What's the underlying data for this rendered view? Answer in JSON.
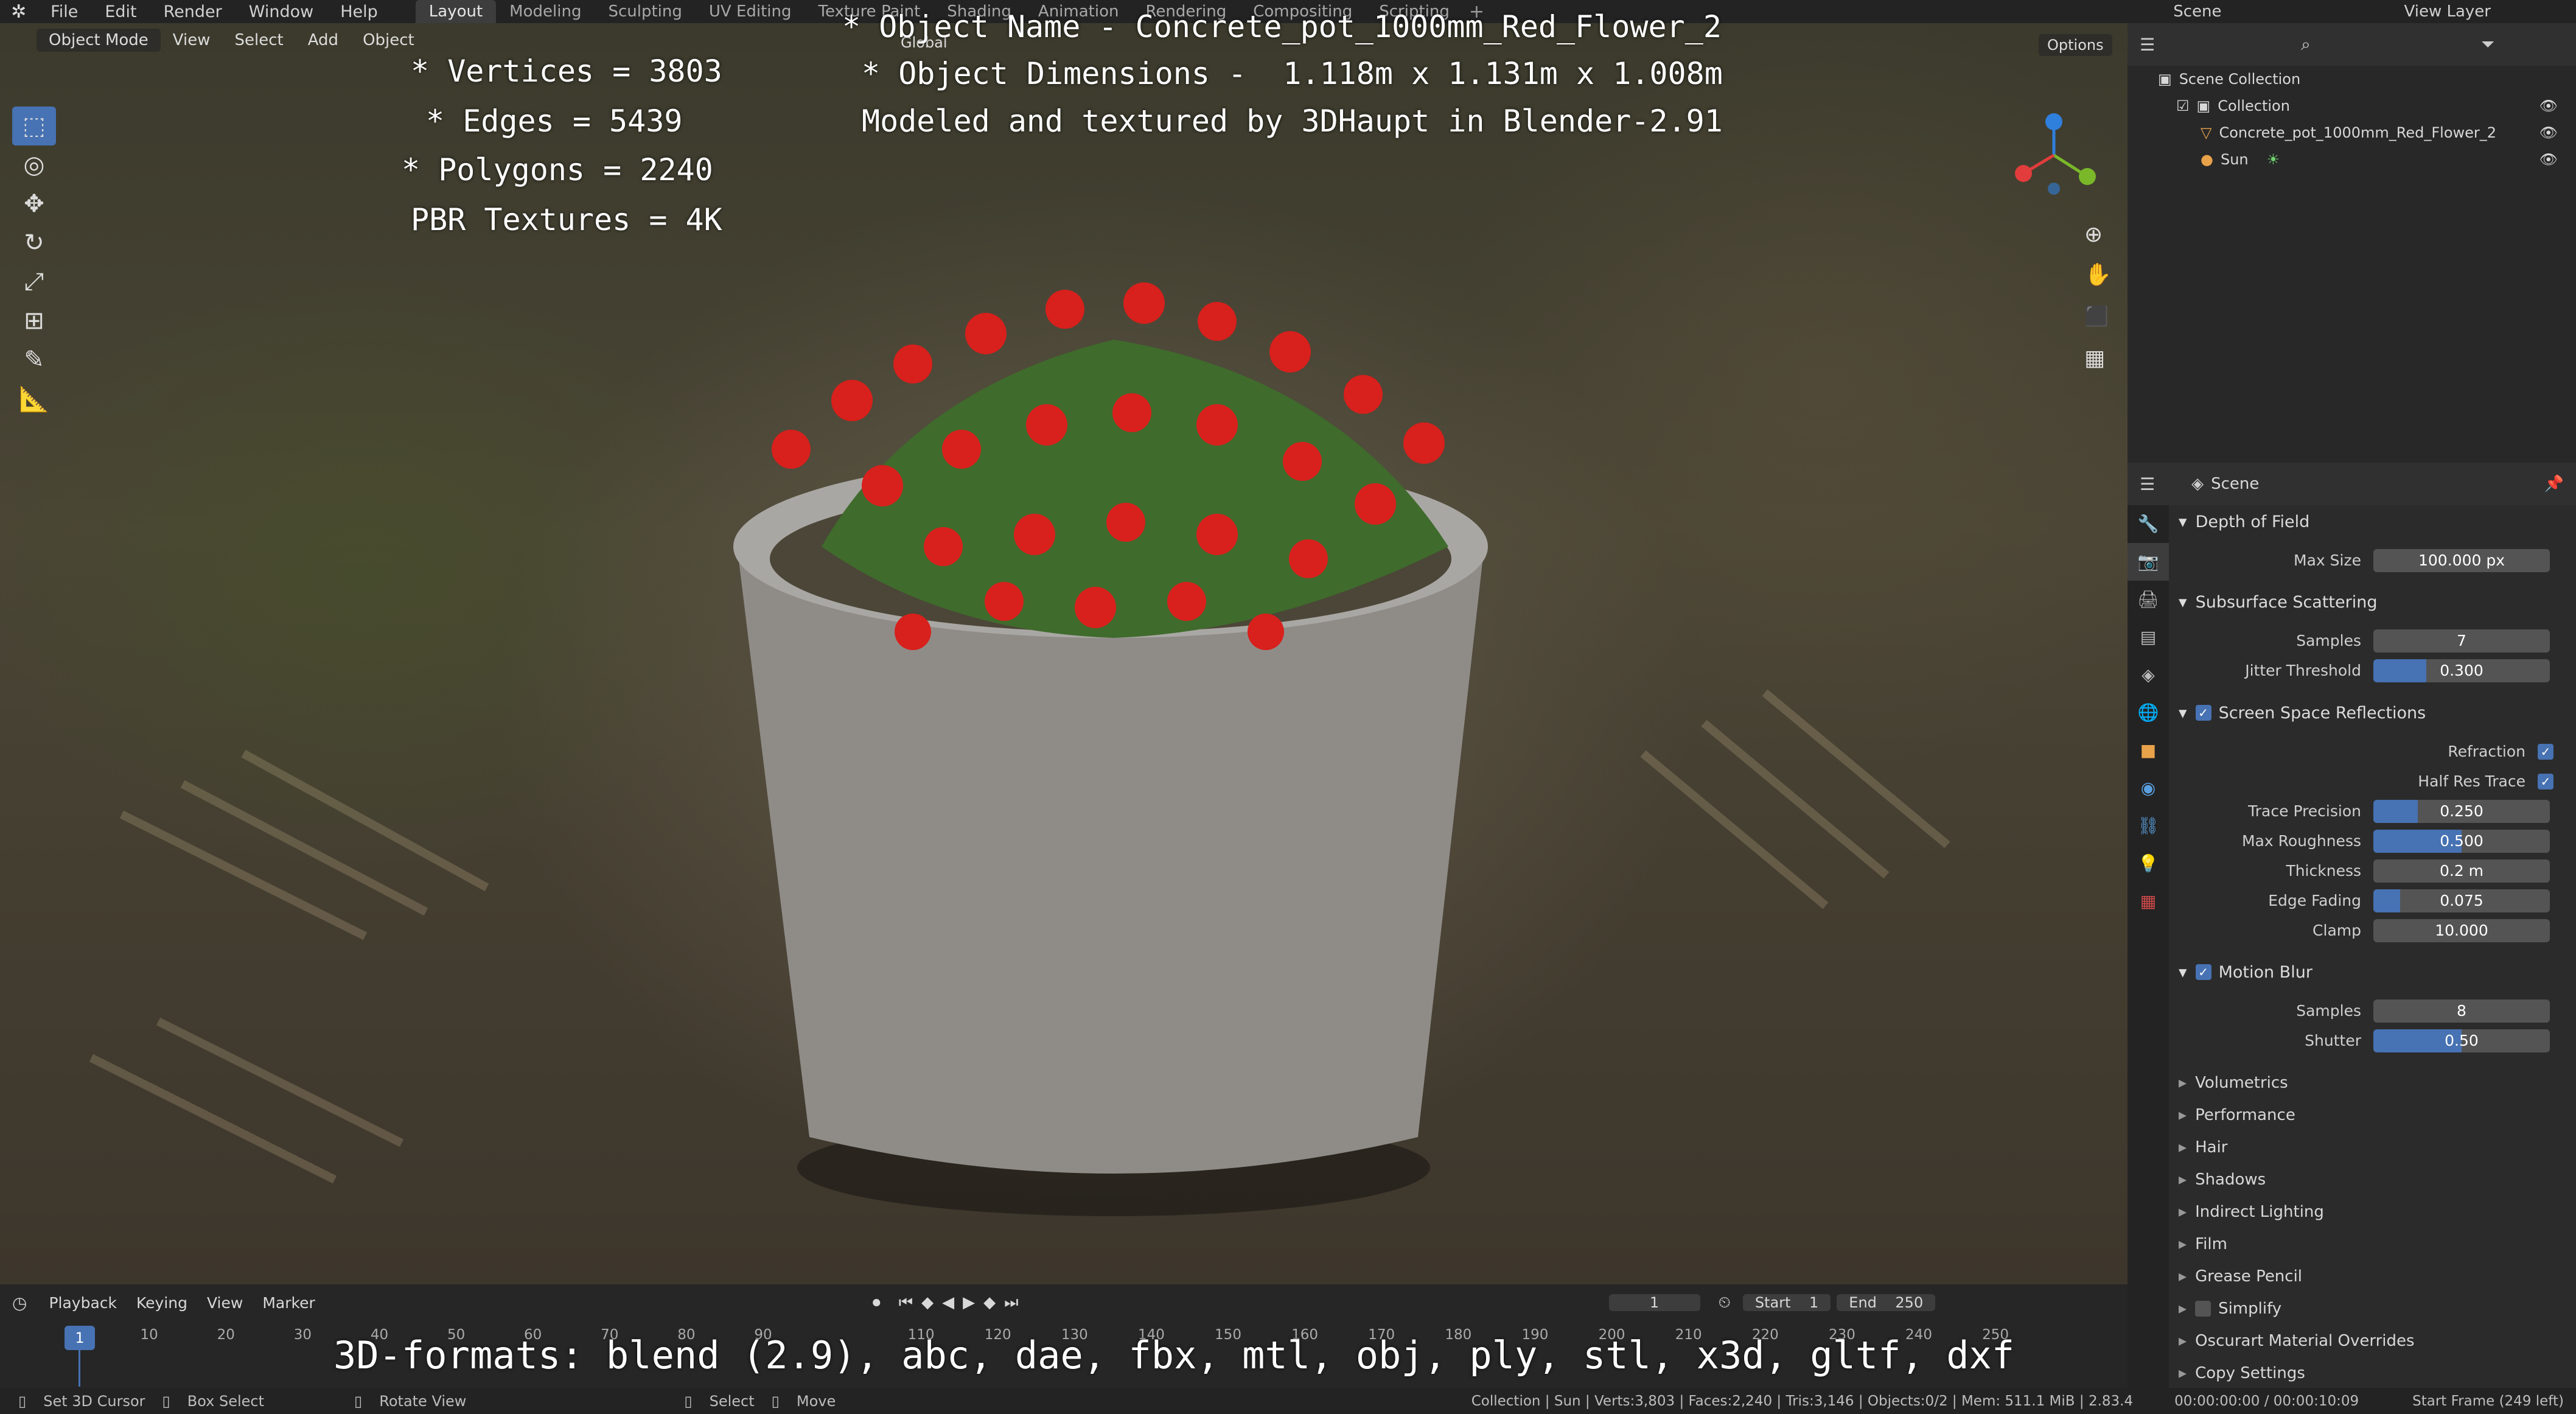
{
  "topbar": {
    "menus": [
      "File",
      "Edit",
      "Render",
      "Window",
      "Help"
    ],
    "workspaces": [
      "Layout",
      "Modeling",
      "Sculpting",
      "UV Editing",
      "Texture Paint",
      "Shading",
      "Animation",
      "Rendering",
      "Compositing",
      "Scripting"
    ],
    "active_workspace": "Layout",
    "scene_label": "Scene",
    "view_layer_label": "View Layer"
  },
  "viewport": {
    "mode": "Object Mode",
    "menus": [
      "View",
      "Select",
      "Add",
      "Object"
    ],
    "transform_orientation": "Global",
    "options_label": "Options"
  },
  "overlay": {
    "stats": [
      "* Vertices = 3803",
      "* Edges = 5439",
      "* Polygons = 2240",
      "PBR Textures = 4K"
    ],
    "info": [
      "* Object Name - Concrete_pot_1000mm_Red_Flower_2",
      "* Object Dimensions -  1.118m x 1.131m x 1.008m",
      "Modeled and textured by 3DHaupt in Blender-2.91"
    ],
    "formats": "3D-formats: blend (2.9), abc, dae, fbx, mtl, obj, ply, stl, x3d, gltf, dxf"
  },
  "outliner": {
    "root": "Scene Collection",
    "collection": "Collection",
    "items": [
      "Concrete_pot_1000mm_Red_Flower_2",
      "Sun"
    ]
  },
  "properties": {
    "context": "Scene",
    "depth_of_field": {
      "title": "Depth of Field",
      "max_size_label": "Max Size",
      "max_size": "100.000 px"
    },
    "sss": {
      "title": "Subsurface Scattering",
      "samples_label": "Samples",
      "samples": "7",
      "jitter_label": "Jitter Threshold",
      "jitter": "0.300",
      "jitter_fill": 0.3
    },
    "ssr": {
      "title": "Screen Space Reflections",
      "refraction_label": "Refraction",
      "half_res_label": "Half Res Trace",
      "trace_label": "Trace Precision",
      "trace": "0.250",
      "trace_fill": 0.25,
      "roughness_label": "Max Roughness",
      "roughness": "0.500",
      "roughness_fill": 0.5,
      "thickness_label": "Thickness",
      "thickness": "0.2 m",
      "fading_label": "Edge Fading",
      "fading": "0.075",
      "fading_fill": 0.15,
      "clamp_label": "Clamp",
      "clamp": "10.000"
    },
    "motion_blur": {
      "title": "Motion Blur",
      "samples_label": "Samples",
      "samples": "8",
      "shutter_label": "Shutter",
      "shutter": "0.50",
      "shutter_fill": 0.5
    },
    "collapsed": [
      "Volumetrics",
      "Performance",
      "Hair",
      "Shadows",
      "Indirect Lighting",
      "Film",
      "Grease Pencil",
      "Simplify",
      "Oscurart Material Overrides",
      "Copy Settings"
    ]
  },
  "timeline": {
    "menus": [
      "Playback",
      "Keying",
      "View",
      "Marker"
    ],
    "current_frame": "1",
    "start_label": "Start",
    "start": "1",
    "end_label": "End",
    "end": "250",
    "ticks": [
      "1",
      "10",
      "20",
      "30",
      "40",
      "50",
      "60",
      "70",
      "80",
      "90",
      "110",
      "120",
      "130",
      "140",
      "150",
      "160",
      "170",
      "180",
      "190",
      "200",
      "210",
      "220",
      "230",
      "240",
      "250"
    ]
  },
  "status": {
    "left": [
      "Set 3D Cursor",
      "Box Select",
      "Rotate View",
      "Select",
      "Move"
    ],
    "stats": "Collection | Sun | Verts:3,803 | Faces:2,240 | Tris:3,146 | Objects:0/2 | Mem: 511.1 MiB | 2.83.4",
    "time": "00:00:00:00 / 00:00:10:09",
    "start_frame": "Start Frame (249 left)"
  }
}
